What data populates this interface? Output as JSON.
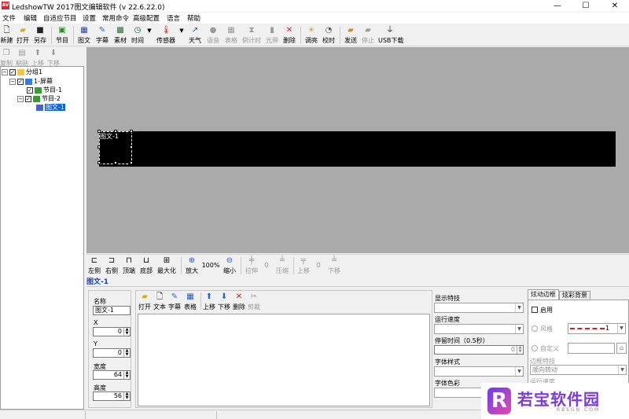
{
  "window": {
    "title": "LedshowTW 2017图文编辑软件 (v 22.6.22.0)",
    "app_icon_text": "AV",
    "min": "—",
    "max": "☐",
    "close": "✕"
  },
  "menu": [
    "文件",
    "编辑",
    "自适应节目",
    "设置",
    "常用命令",
    "高级配置",
    "语言",
    "帮助"
  ],
  "toolbar": [
    {
      "label": "新建",
      "icon": "new-file-icon",
      "enabled": true
    },
    {
      "label": "打开",
      "icon": "open-folder-icon",
      "enabled": true
    },
    {
      "label": "另存",
      "icon": "save-icon",
      "enabled": true
    },
    {
      "label": "节目",
      "icon": "program-icon",
      "enabled": true
    },
    {
      "label": "图文",
      "icon": "image-text-icon",
      "enabled": true
    },
    {
      "label": "字幕",
      "icon": "subtitle-icon",
      "enabled": true
    },
    {
      "label": "素材",
      "icon": "material-icon",
      "enabled": true
    },
    {
      "label": "时间",
      "icon": "clock-icon",
      "enabled": true
    },
    {
      "label": "传感器",
      "icon": "sensor-icon",
      "enabled": true
    },
    {
      "label": "天气",
      "icon": "weather-icon",
      "enabled": true
    },
    {
      "label": "语音",
      "icon": "voice-icon",
      "enabled": false
    },
    {
      "label": "表格",
      "icon": "table-icon",
      "enabled": false
    },
    {
      "label": "倒计时",
      "icon": "countdown-icon",
      "enabled": false
    },
    {
      "label": "光带",
      "icon": "light-band-icon",
      "enabled": false
    },
    {
      "label": "删除",
      "icon": "delete-icon",
      "enabled": true
    },
    {
      "label": "调亮",
      "icon": "brightness-icon",
      "enabled": true
    },
    {
      "label": "校时",
      "icon": "time-sync-icon",
      "enabled": true
    },
    {
      "label": "发送",
      "icon": "send-icon",
      "enabled": true
    },
    {
      "label": "停止",
      "icon": "stop-icon",
      "enabled": false
    },
    {
      "label": "USB下载",
      "icon": "usb-icon",
      "enabled": true
    }
  ],
  "left_toolbar": [
    {
      "label": "复制",
      "enabled": false
    },
    {
      "label": "粘贴",
      "enabled": false
    },
    {
      "label": "上移",
      "enabled": false
    },
    {
      "label": "下移",
      "enabled": false
    }
  ],
  "tree": [
    {
      "label": "分组1",
      "level": 0
    },
    {
      "label": "1-屏幕",
      "level": 1
    },
    {
      "label": "节目-1",
      "level": 2
    },
    {
      "label": "节目-2",
      "level": 2
    },
    {
      "label": "图文-1",
      "level": 3,
      "selected": true
    }
  ],
  "canvas": {
    "area_label": "图文-1"
  },
  "align_toolbar": [
    {
      "label": "左侧",
      "enabled": true
    },
    {
      "label": "右侧",
      "enabled": true
    },
    {
      "label": "顶端",
      "enabled": true
    },
    {
      "label": "底部",
      "enabled": true
    },
    {
      "label": "最大化",
      "enabled": true
    },
    {
      "label": "放大",
      "enabled": true
    },
    {
      "label": "100%",
      "enabled": true
    },
    {
      "label": "缩小",
      "enabled": true
    },
    {
      "label": "拉伸",
      "enabled": false
    },
    {
      "label": "0",
      "enabled": false
    },
    {
      "label": "压缩",
      "enabled": false
    },
    {
      "label": "上移",
      "enabled": false
    },
    {
      "label": "0",
      "enabled": false
    },
    {
      "label": "下移",
      "enabled": false
    }
  ],
  "selected_title": "图文-1",
  "props": {
    "name_label": "名称",
    "name_value": "图文-1",
    "x_label": "X",
    "x_value": "0",
    "y_label": "Y",
    "y_value": "0",
    "width_label": "宽度",
    "width_value": "64",
    "height_label": "高度",
    "height_value": "56"
  },
  "file_toolbar": [
    "打开",
    "文本",
    "字幕",
    "表格",
    "上移",
    "下移",
    "删除",
    "剪裁"
  ],
  "effects": {
    "display_label": "显示特技",
    "speed_label": "运行速度",
    "stay_label": "停留时间（0.5秒）",
    "stay_value": "0",
    "font_style_label": "字体样式",
    "font_color_label": "字体色彩"
  },
  "border": {
    "tab_border": "炫动边框",
    "tab_bg": "炫彩背景",
    "enable_label": "启用",
    "style_label": "风格",
    "style_value": "1",
    "custom_label": "自定义",
    "effect_label": "边框特技",
    "effect_value": "顺向转动",
    "speed_label": "运行速度"
  },
  "watermark": {
    "title": "若宝软件园",
    "url": "RBSGN.COM"
  },
  "colors": {
    "canvas": "#aaaaaa",
    "screen": "#000000",
    "accent": "#1144cc"
  }
}
